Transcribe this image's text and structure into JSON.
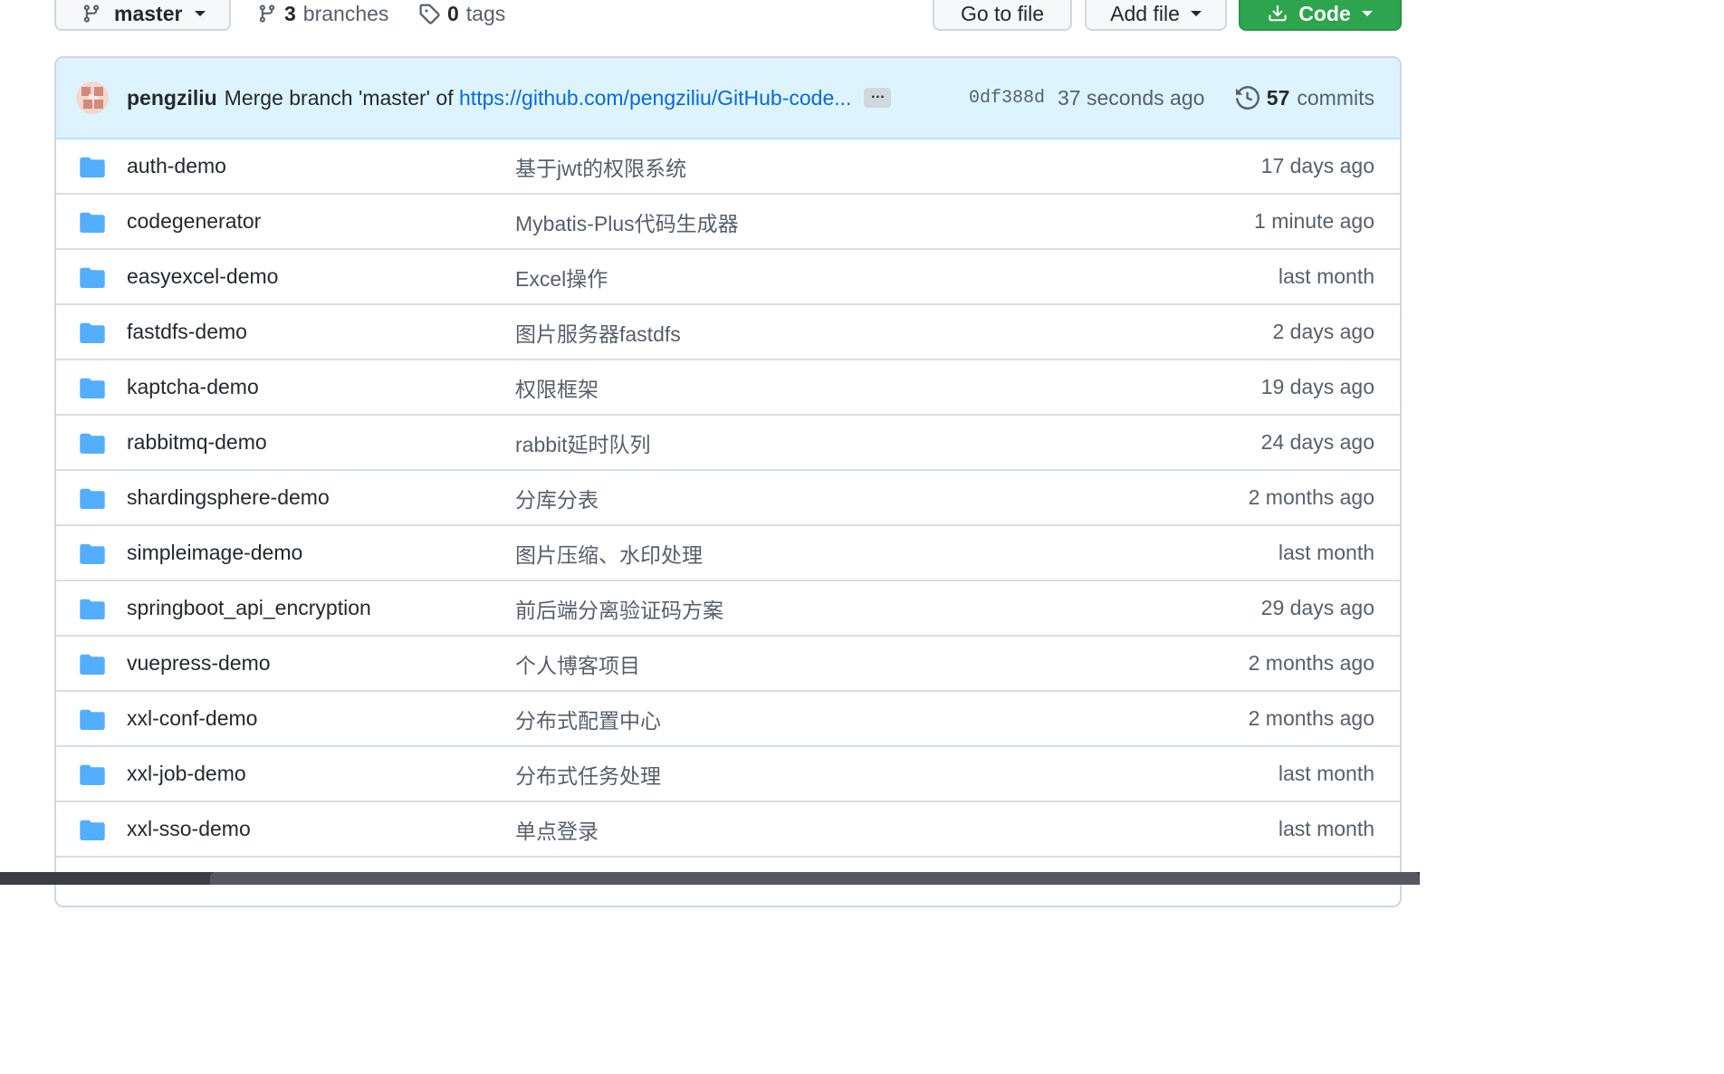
{
  "toolbar": {
    "branch_label": "master",
    "branches_count": "3",
    "branches_label": "branches",
    "tags_count": "0",
    "tags_label": "tags",
    "goto_file_label": "Go to file",
    "add_file_label": "Add file",
    "code_label": "Code"
  },
  "commit": {
    "author": "pengziliu",
    "message_prefix": "Merge branch 'master' of ",
    "message_link": "https://github.com/pengziliu/GitHub-code...",
    "ellipsis": "…",
    "sha": "0df388d",
    "time": "37 seconds ago",
    "commits_count": "57",
    "commits_label": "commits"
  },
  "files": [
    {
      "name": "auth-demo",
      "message": "基于jwt的权限系统",
      "time": "17 days ago"
    },
    {
      "name": "codegenerator",
      "message": "Mybatis-Plus代码生成器",
      "time": "1 minute ago"
    },
    {
      "name": "easyexcel-demo",
      "message": "Excel操作",
      "time": "last month"
    },
    {
      "name": "fastdfs-demo",
      "message": "图片服务器fastdfs",
      "time": "2 days ago"
    },
    {
      "name": "kaptcha-demo",
      "message": "权限框架",
      "time": "19 days ago"
    },
    {
      "name": "rabbitmq-demo",
      "message": "rabbit延时队列",
      "time": "24 days ago"
    },
    {
      "name": "shardingsphere-demo",
      "message": "分库分表",
      "time": "2 months ago"
    },
    {
      "name": "simpleimage-demo",
      "message": "图片压缩、水印处理",
      "time": "last month"
    },
    {
      "name": "springboot_api_encryption",
      "message": "前后端分离验证码方案",
      "time": "29 days ago"
    },
    {
      "name": "vuepress-demo",
      "message": "个人博客项目",
      "time": "2 months ago"
    },
    {
      "name": "xxl-conf-demo",
      "message": "分布式配置中心",
      "time": "2 months ago"
    },
    {
      "name": "xxl-job-demo",
      "message": "分布式任务处理",
      "time": "last month"
    },
    {
      "name": "xxl-sso-demo",
      "message": "单点登录",
      "time": "last month"
    }
  ],
  "colors": {
    "folder": "#54aeff",
    "link": "#0969da",
    "code_button": "#2da44e",
    "commit_bar": "#ddf4ff"
  }
}
